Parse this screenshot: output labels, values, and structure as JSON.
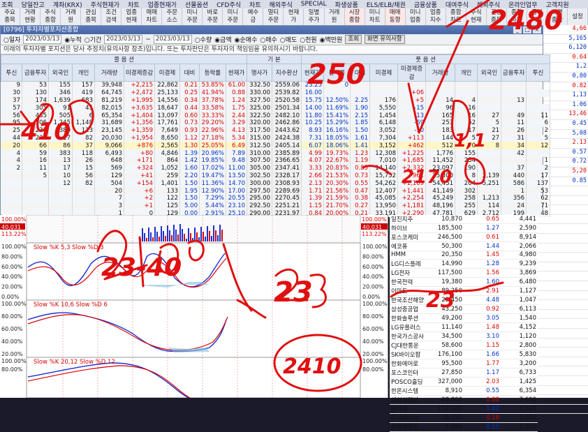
{
  "menu": [
    "조회",
    "당일잔고",
    "계좌(KRX)",
    "주식현재가",
    "차트",
    "업종현재가",
    "선물옵션",
    "CFD주식",
    "차트",
    "해외주식",
    "SPECIAL",
    "파생상품",
    "ELS/ELB/채권",
    "금융상품",
    "대여주식",
    "해외주식",
    "온라인업무",
    "고객지원"
  ],
  "toolbar": [
    {
      "l1": "주요",
      "l2": "종목"
    },
    {
      "l1": "거래",
      "l2": "현황"
    },
    {
      "l1": "주식",
      "l2": "종합"
    },
    {
      "l1": "거래",
      "l2": "원"
    },
    {
      "l1": "관심",
      "l2": "종목"
    },
    {
      "l1": "조건",
      "l2": "검색"
    },
    {
      "l1": "업종",
      "l2": "현재"
    },
    {
      "l1": "매매",
      "l2": "차트"
    },
    {
      "l1": "주문",
      "l2": "소스"
    },
    {
      "l1": "미니",
      "l2": "주문"
    },
    {
      "l1": "바로",
      "l2": "주문"
    },
    {
      "l1": "미니",
      "l2": "주문"
    },
    {
      "l1": "예수",
      "l2": "금"
    },
    {
      "l1": "멀티",
      "l2": "주문"
    },
    {
      "l1": "현재",
      "l2": "가"
    },
    {
      "l1": "일별",
      "l2": "주가"
    },
    {
      "l1": "거래",
      "l2": "원"
    },
    {
      "l1": "시장",
      "l2": "종합"
    },
    {
      "l1": "미니",
      "l2": "차트"
    },
    {
      "l1": "매매",
      "l2": "동향"
    },
    {
      "l1": "미니",
      "l2": "업종"
    },
    {
      "l1": "업종",
      "l2": "지수"
    },
    {
      "l1": "종합",
      "l2": "차트"
    },
    {
      "l1": "주식",
      "l2": "현재"
    },
    {
      "l1": "관심",
      "l2": "종목"
    },
    {
      "l1": "종합",
      "l2": "차트"
    },
    {
      "l1": "금리",
      "l2": "지표"
    },
    {
      "l1": "화면",
      "l2": "종합"
    },
    {
      "l1": "설정",
      "l2": ""
    }
  ],
  "window": {
    "title": "[0796] 투자자별포지션종합",
    "filter": {
      "r1": "일자",
      "date1": "2023/03/13",
      "r2": "누적",
      "r3": "기간",
      "date2": "2023/03/13",
      "tilde": "~",
      "date3": "2023/03/13",
      "q1": "수량",
      "q2": "금액",
      "q3": "순매수",
      "q4": "매수",
      "q5": "매도",
      "unit1": "천원",
      "unit2": "백만원",
      "btn1": "조회",
      "btn2": "화면 유의사항"
    },
    "notice": "이래의 투자자별 포지션은 당사 추정치(유의사항 참조)입니다. 또는 투자판단은 투자자의 책임임을 유의하시기 바랍니다.",
    "headers_top": {
      "left": "콜 옵 션",
      "mid": "기 본",
      "right": "풋 옵 션"
    },
    "headers": [
      "투신",
      "금융투자",
      "외국인",
      "개인",
      "거래량",
      "미결제증감",
      "미결제",
      "대비",
      "등락률",
      "현재가",
      "행사가",
      "지수환산",
      "현재가",
      "등락률",
      "대비",
      "미결제",
      "미결제증감",
      "거래량",
      "개인",
      "외국인",
      "금융투자",
      "투신"
    ],
    "rows": [
      [
        "9",
        "53",
        "155",
        "157",
        "39,948",
        "+2,215",
        "22,862",
        "0.21",
        "53.85%",
        "61.00",
        "332.50",
        "2559.06",
        "23.25",
        "0",
        "",
        "",
        "",
        "",
        "",
        "",
        "",
        ""
      ],
      [
        "30",
        "130",
        "346",
        "419",
        "64,745",
        "+2,472",
        "25,133",
        "0.25",
        "41.94%",
        "0.88",
        "330.00",
        "2539.82",
        "16.00",
        "",
        "",
        "",
        "+06",
        "",
        "",
        "",
        "",
        ""
      ],
      [
        "37",
        "174",
        "1,639",
        "683",
        "81,219",
        "+1,995",
        "14,556",
        "0.34",
        "37.78%",
        "1.24",
        "327.50",
        "2520.58",
        "15.75",
        "12.50%",
        "2.25",
        "176",
        "+5",
        "14",
        "4",
        "",
        "13",
        ""
      ],
      [
        "57",
        "305",
        "91",
        "45",
        "82,015",
        "+3,635",
        "18,647",
        "0.44",
        "33.58%",
        "1.75",
        "325.00",
        "2501.34",
        "14.00",
        "11.69%",
        "1.90",
        "5,550",
        "-15",
        "96",
        "16",
        "",
        "",
        ""
      ],
      [
        "56",
        "435",
        "505",
        "6",
        "65,354",
        "+1,404",
        "13,097",
        "0.60",
        "33.33%",
        "2.44",
        "322.50",
        "2482.10",
        "11.80",
        "15.41%",
        "2.15",
        "1,454",
        "-13",
        "165",
        "16",
        "27",
        "49",
        "11"
      ],
      [
        "95",
        "506",
        "1,245",
        "1,148",
        "31,689",
        "+1,356",
        "17,761",
        "0.73",
        "29.20%",
        "3.29",
        "320.00",
        "2462.86",
        "10.25",
        "15.29%",
        "1.85",
        "6,148",
        "-69",
        "253",
        "52",
        "5",
        "11",
        "6"
      ],
      [
        "25",
        "231",
        "380",
        "113",
        "23,145",
        "+1,359",
        "7,649",
        "0.93",
        "22.96%",
        "4.13",
        "317.50",
        "2443.62",
        "8.93",
        "16.16%",
        "1.50",
        "3,052",
        "-10",
        "183",
        "17",
        "21",
        "26",
        "2"
      ],
      [
        "44",
        "230",
        "17",
        "82",
        "20,030",
        "+1,954",
        "8,650",
        "1.12",
        "27.18%",
        "5.34",
        "315.00",
        "2424.38",
        "7.31",
        "18.05%",
        "1.61",
        "7,304",
        "+113",
        "144",
        "5",
        "27",
        "31",
        "5"
      ],
      [
        "20",
        "66",
        "86",
        "37",
        "9,066",
        "+876",
        "2,565",
        "1.30",
        "25.05%",
        "6.49",
        "312.50",
        "2405.14",
        "6.07",
        "18.06%",
        "1.41",
        "3,152",
        "+462",
        "512",
        "70",
        "8",
        "34",
        "12"
      ],
      [
        "4",
        "59",
        "383",
        "118",
        "6,493",
        "+80",
        "4,846",
        "1.39",
        "20.96%",
        "7.89",
        "310.00",
        "2385.89",
        "4.99",
        "19.73%",
        "1.23",
        "12,308",
        "+1,225",
        "1,776",
        "155",
        "",
        "42",
        ""
      ],
      [
        "4",
        "16",
        "13",
        "26",
        "648",
        "+171",
        "864",
        "1.42",
        "19.85%",
        "9.48",
        "307.50",
        "2366.65",
        "4.07",
        "22.67%",
        "1.19",
        "7,010",
        "+1,685",
        "11,452",
        "234",
        "",
        "",
        "1"
      ],
      [
        "2",
        "11",
        "17",
        "15",
        "569",
        "+324",
        "1,052",
        "1.60",
        "17.02%",
        "11.00",
        "305.00",
        "2347.41",
        "3.33",
        "20.83%",
        "0.85",
        "14,140",
        "+2,332",
        "23,097",
        "190",
        "",
        "37",
        "2"
      ],
      [
        "",
        "5",
        "10",
        "56",
        "129",
        "+41",
        "259",
        "2.20",
        "19.47%",
        "13.50",
        "302.50",
        "2328.17",
        "2.66",
        "21.53%",
        "0.73",
        "15,752",
        "+961",
        "25,300",
        "8",
        "2,139",
        "440",
        "17"
      ],
      [
        "",
        "",
        "12",
        "82",
        "504",
        "+154",
        "1,401",
        "1.50",
        "11.36%",
        "14.70",
        "300.00",
        "2308.93",
        "2.13",
        "20.30%",
        "0.55",
        "54,262",
        "+1,169",
        "54,451",
        "204",
        "5,251",
        "586",
        "137"
      ],
      [
        "",
        "",
        "",
        "",
        "20",
        "+6",
        "133",
        "1.95",
        "12.90%",
        "17.00",
        "297.50",
        "2289.69",
        "1.71",
        "21.56%",
        "0.47",
        "12,407",
        "+1,441",
        "41,149",
        "302",
        "",
        "1",
        "53"
      ],
      [
        "",
        "",
        "",
        "",
        "7",
        "+2",
        "122",
        "1.50",
        "7.29%",
        "20.55",
        "295.00",
        "2270.45",
        "1.39",
        "21.59%",
        "0.38",
        "45,085",
        "+2,254",
        "45,249",
        "258",
        "1,213",
        "356",
        "62"
      ],
      [
        "",
        "",
        "",
        "",
        "3",
        "+1",
        "125",
        "5.00",
        "5.44%",
        "23.10",
        "292.50",
        "2251.21",
        "1.15",
        "21.70%",
        "0.27",
        "13,950",
        "+1,181",
        "48,196",
        "255",
        "114",
        "24",
        "71"
      ],
      [
        "",
        "",
        "",
        "",
        "1",
        "0",
        "129",
        "0.00",
        "2.91%",
        "25.10",
        "290.00",
        "2231.97",
        "0.84",
        "20.00%",
        "0.21",
        "33,191",
        "+2,290",
        "47,781",
        "629",
        "2,712",
        "199",
        "48"
      ]
    ]
  },
  "chart": {
    "price_left": [
      "100.00%",
      "40,031",
      "113.22%"
    ],
    "price_right": [
      "100.00%",
      "40,031",
      "113.22%"
    ],
    "panels": [
      {
        "label": "Slow %K 5,3  Slow %D 3",
        "ticks": [
          "100.00%",
          "80.00%",
          "60.00%",
          "40.00%",
          "20.00%",
          "0.00%"
        ]
      },
      {
        "label": "Slow %K 10,6  Slow %D 6",
        "ticks": [
          "100.00%",
          "80.00%",
          "60.00%",
          "40.00%",
          "20.00%"
        ]
      },
      {
        "label": "Slow %K 20,12  Slow %D 12",
        "ticks": [
          "100.00%",
          "80.00%"
        ]
      }
    ]
  },
  "bottom_list": [
    [
      "일진지주",
      "10,870",
      "0.65",
      "4,441"
    ],
    [
      "하이브",
      "185,500",
      "1.27",
      "2,590"
    ],
    [
      "포스코케미",
      "246,500",
      "0.61",
      "8,914"
    ],
    [
      "에코퓨",
      "50,300",
      "1.44",
      "2,066"
    ],
    [
      "HMM",
      "20,350",
      "1.45",
      "4,980"
    ],
    [
      "LG디스플레",
      "14,990",
      "1.28",
      "9,239"
    ],
    [
      "LG전자",
      "117,500",
      "1.56",
      "3,869"
    ],
    [
      "한국전력",
      "19,380",
      "1.60",
      "6,480"
    ],
    [
      "이마트",
      "89,250",
      "2.91",
      "1,127"
    ],
    [
      "한국조선해양",
      "29,450",
      "4.48",
      "1,047"
    ],
    [
      "삼성중공업",
      "43,250",
      "0.92",
      "6,113"
    ],
    [
      "한화솔루션",
      "49,200",
      "3.05",
      "1,540"
    ],
    [
      "LG유플러스",
      "11,140",
      "1.48",
      "4,152"
    ],
    [
      "한국가스공사",
      "34,500",
      "3.10",
      "1,120"
    ],
    [
      "CJ대한통운",
      "58,600",
      "1.15",
      "2,800"
    ],
    [
      "SK바이오팜",
      "176,100",
      "1.66",
      "5,830"
    ],
    [
      "한화에어로",
      "95,500",
      "1.77",
      "3,200"
    ],
    [
      "포스코인터",
      "27,850",
      "1.17",
      "6,733"
    ],
    [
      "POSCO홀딩",
      "327,000",
      "2.03",
      "1,425"
    ],
    [
      "한온시스템",
      "8,910",
      "0.55",
      "6,354"
    ],
    [
      "에이치엘비",
      "28,800",
      "0.88",
      "7,600"
    ],
    [
      "현대차",
      "172,000",
      "1.42",
      "4,520"
    ],
    [
      "두산에너빌",
      "39,550",
      "0.18",
      "6,000"
    ],
    [
      "미래에셋증",
      "7,650",
      "0.55",
      "5,320"
    ]
  ],
  "right_col": [
    "4,66",
    "5,165",
    "6,120",
    "0.64",
    "1,2",
    "0,80",
    "0.82",
    "1,13",
    "1.06",
    "13,46",
    "0.45",
    "5,08",
    "2.13",
    "0.57",
    "0.72",
    "5,20",
    "0.85",
    "",
    "",
    "",
    "",
    "",
    "",
    "",
    "",
    "",
    "",
    "",
    "",
    "",
    "",
    "",
    "",
    "",
    "",
    "",
    "",
    "",
    "",
    "",
    ""
  ],
  "annotations": [
    "2480",
    "250",
    "23-40",
    "23",
    "2410",
    "2170",
    "410",
    "1,1",
    "23"
  ]
}
